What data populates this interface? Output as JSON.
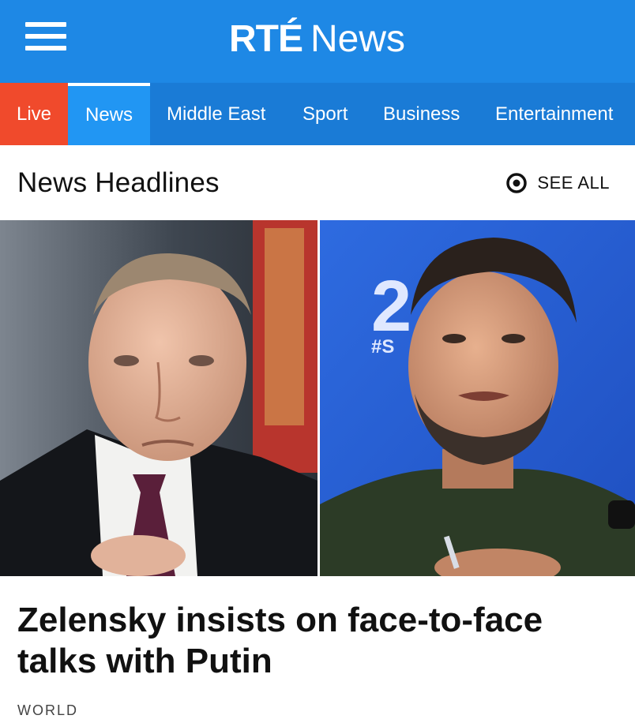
{
  "app": {
    "brand": "RTÉ",
    "brand_product": "News"
  },
  "nav": {
    "items": [
      {
        "label": "Live"
      },
      {
        "label": "News"
      },
      {
        "label": "Middle East"
      },
      {
        "label": "Sport"
      },
      {
        "label": "Business"
      },
      {
        "label": "Entertainment"
      }
    ],
    "active": "News"
  },
  "section": {
    "title": "News Headlines",
    "see_all_label": "SEE ALL"
  },
  "article": {
    "headline": "Zelensky insists on face-to-face talks with Putin",
    "category": "WORLD"
  },
  "colors": {
    "header_blue": "#1e88e5",
    "nav_blue": "#1a7bd6",
    "active_tab": "#2196f3",
    "live_red": "#f04a2c"
  },
  "icons": {
    "menu": "hamburger-menu-icon",
    "see_all": "eye-icon"
  }
}
